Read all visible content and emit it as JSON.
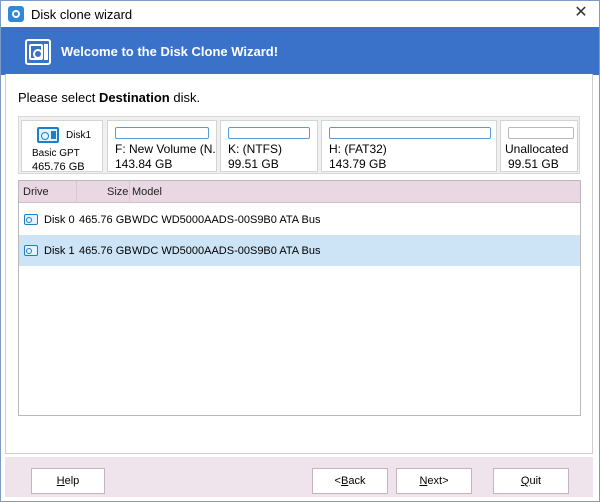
{
  "window": {
    "title": "Disk clone wizard",
    "close_glyph": "✕"
  },
  "banner": {
    "title": "Welcome to the Disk Clone Wizard!",
    "icon": "disk-clone-icon"
  },
  "prompt": {
    "prefix": "Please select ",
    "bold": "Destination",
    "suffix": " disk."
  },
  "disk_map": {
    "disk": {
      "name": "Disk1",
      "type": "Basic GPT",
      "size": "465.76 GB",
      "icon": "hard-disk-icon"
    },
    "partitions": [
      {
        "label": "F: New Volume (N...",
        "size": "143.84 GB"
      },
      {
        "label": "K: (NTFS)",
        "size": "99.51 GB"
      },
      {
        "label": "H: (FAT32)",
        "size": "143.79 GB"
      },
      {
        "label": "Unallocated",
        "size": "99.51 GB"
      }
    ]
  },
  "table": {
    "columns": [
      "Drive",
      "Size",
      "Model"
    ],
    "rows": [
      {
        "drive": "Disk 0",
        "size": "465.76 GB",
        "model": "WDC WD5000AADS-00S9B0 ATA Bus",
        "selected": false
      },
      {
        "drive": "Disk 1",
        "size": "465.76 GB",
        "model": "WDC WD5000AADS-00S9B0 ATA Bus",
        "selected": true
      }
    ],
    "selection_color": "#cde4f7",
    "header_color": "#e9d8e3"
  },
  "buttons": {
    "help": {
      "label": "Help",
      "underline": "H"
    },
    "back": {
      "label": "<Back",
      "underline": "B"
    },
    "next": {
      "label": "Next>",
      "underline": "N"
    },
    "quit": {
      "label": "Quit",
      "underline": "Q"
    }
  },
  "colors": {
    "banner": "#3a72c9",
    "footer": "#efe3ec",
    "accent": "#1e7fc8"
  }
}
